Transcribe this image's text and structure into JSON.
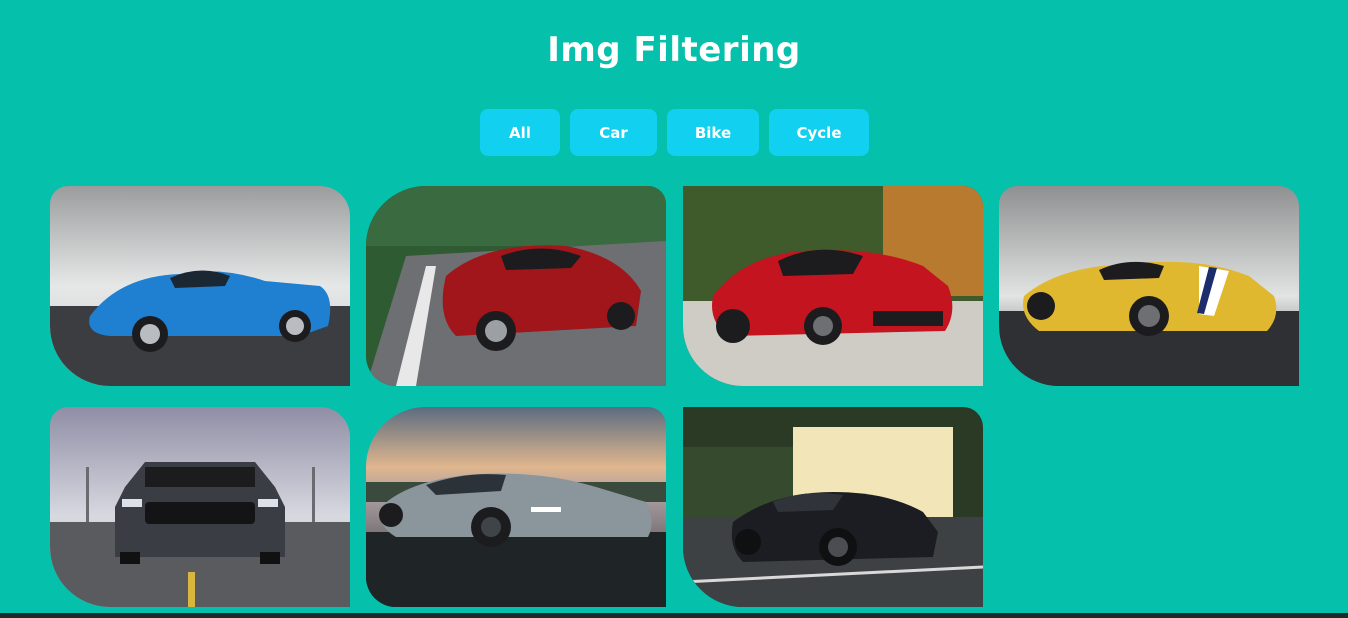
{
  "page": {
    "title": "Img Filtering",
    "background_color": "#05c0ab",
    "button_color": "#12d0ef"
  },
  "filters": [
    {
      "label": "All"
    },
    {
      "label": "Car"
    },
    {
      "label": "Bike"
    },
    {
      "label": "Cycle"
    }
  ],
  "gallery": [
    {
      "category": "car",
      "car_color": "#1f7fd0",
      "scene": "cloudy-road"
    },
    {
      "category": "car",
      "car_color": "#a0161a",
      "scene": "mountain-road"
    },
    {
      "category": "car",
      "car_color": "#c4141f",
      "scene": "forest-lot"
    },
    {
      "category": "car",
      "car_color": "#e0b830",
      "scene": "cloudy-road"
    },
    {
      "category": "car",
      "car_color": "#3a3d44",
      "scene": "runway"
    },
    {
      "category": "car",
      "car_color": "#8b969c",
      "scene": "sunset"
    },
    {
      "category": "car",
      "car_color": "#1b1d22",
      "scene": "park-lot"
    }
  ]
}
